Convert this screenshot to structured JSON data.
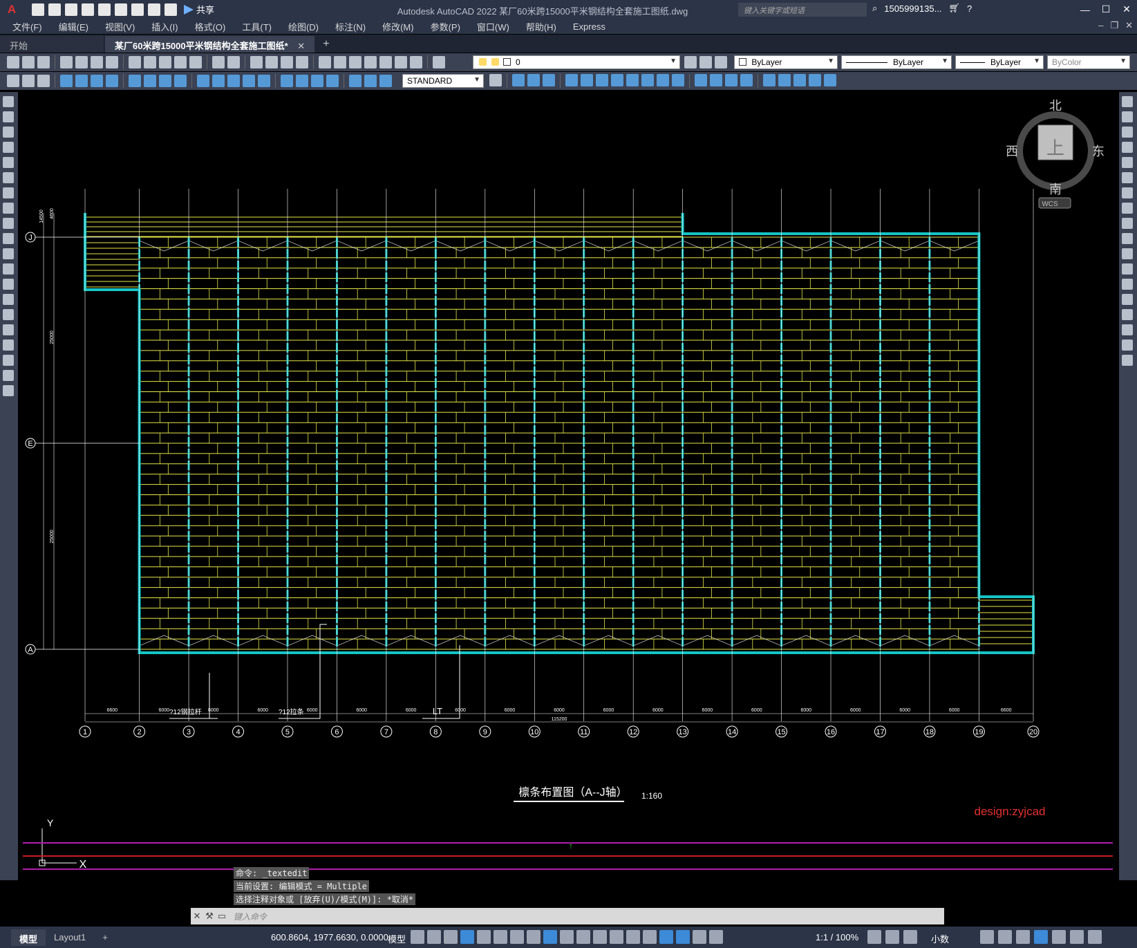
{
  "titlebar": {
    "app_logo": "A",
    "share_label": "共享",
    "window_title": "Autodesk AutoCAD 2022    某厂60米跨15000平米钢结构全套施工图纸.dwg",
    "search_placeholder": "键入关键字或短语",
    "user": "1505999135...",
    "min": "—",
    "max": "☐",
    "close": "✕"
  },
  "menu": [
    "文件(F)",
    "编辑(E)",
    "视图(V)",
    "插入(I)",
    "格式(O)",
    "工具(T)",
    "绘图(D)",
    "标注(N)",
    "修改(M)",
    "参数(P)",
    "窗口(W)",
    "帮助(H)",
    "Express"
  ],
  "tabs": {
    "start": "开始",
    "active": "某厂60米跨15000平米钢结构全套施工图纸*",
    "close": "✕",
    "add": "+"
  },
  "toolbar": {
    "layer": "0",
    "color": "ByLayer",
    "linetype": "ByLayer",
    "lineweight": "ByLayer",
    "plotstyle": "ByColor",
    "textstyle": "STANDARD"
  },
  "viewcube": {
    "north": "北",
    "south": "南",
    "east": "东",
    "west": "西",
    "top": "上",
    "wcs": "WCS"
  },
  "drawing": {
    "title": "檩条布置图（A--J轴）",
    "scale": "1:160",
    "watermark": "design:zyjcad",
    "axis_letters": [
      "J",
      "E",
      "A"
    ],
    "axis_numbers": [
      "1",
      "2",
      "3",
      "4",
      "5",
      "6",
      "7",
      "8",
      "9",
      "10",
      "11",
      "12",
      "13",
      "14",
      "15",
      "16",
      "17",
      "18",
      "19",
      "20"
    ],
    "spans": [
      "6600",
      "6000",
      "6000",
      "6000",
      "6000",
      "6000",
      "6000",
      "6000",
      "6000",
      "6000",
      "6000",
      "6000",
      "6000",
      "6000",
      "6000",
      "6000",
      "6000",
      "6000",
      "6600"
    ],
    "total": "115200",
    "left_dims": [
      "14500",
      "4600",
      "25000",
      "25000"
    ],
    "labels": [
      "?12钢拉杆",
      "?12拉条",
      "LT"
    ],
    "ucs_y": "Y",
    "ucs_x": "X"
  },
  "command": {
    "history": [
      "命令: _textedit",
      "当前设置: 编辑模式 = Multiple",
      "选择注释对象或 [放弃(U)/模式(M)]: *取消*"
    ],
    "placeholder": "键入命令"
  },
  "status": {
    "model_tab": "模型",
    "layout_tab": "Layout1",
    "add": "+",
    "coords": "600.8604, 1977.6630, 0.0000",
    "model": "模型",
    "scale": "1:1 / 100%",
    "units": "小数"
  },
  "colors": {
    "purlin": "#e8e84a",
    "steel": "#15c4c4",
    "grid": "#ffffff",
    "title_bar": "#2c3447",
    "toolbar": "#3b4254",
    "watermark": "#e33030"
  }
}
